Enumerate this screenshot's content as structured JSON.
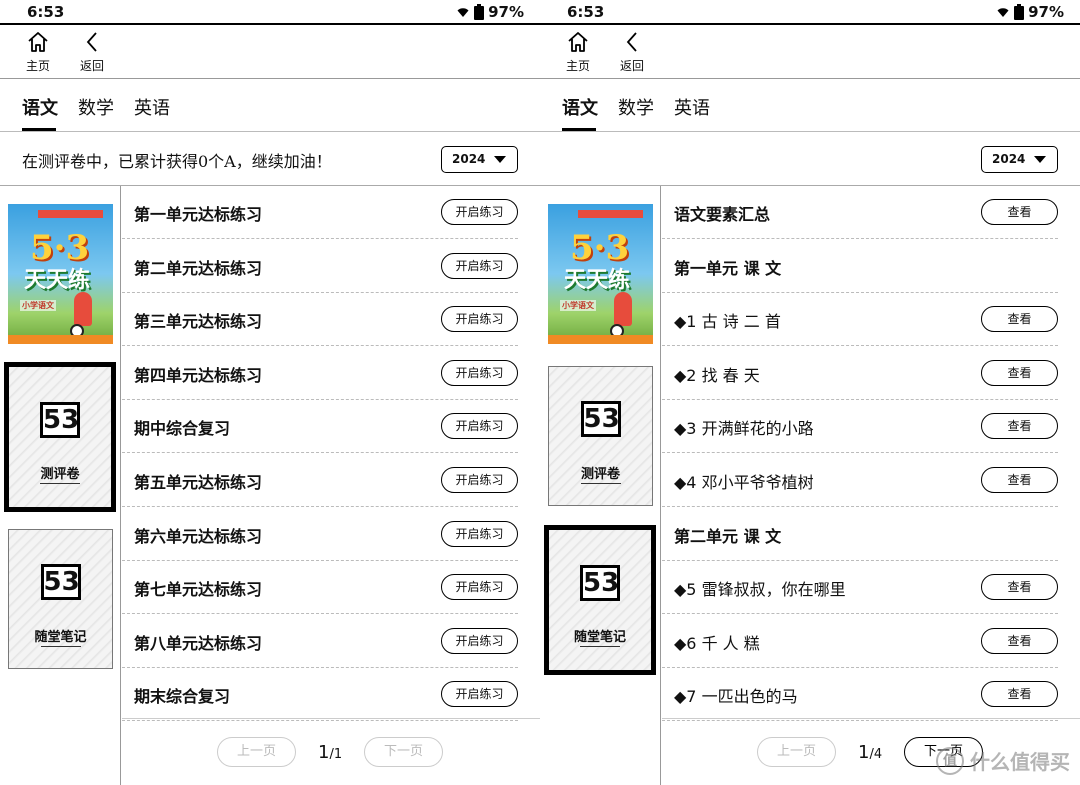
{
  "status": {
    "time": "6:53",
    "battery": "97%"
  },
  "nav": {
    "home_label": "主页",
    "back_label": "返回"
  },
  "tabs": [
    "语文",
    "数学",
    "英语"
  ],
  "notice": "在测评卷中，已累计获得0个A，继续加油！",
  "year": "2024",
  "sidebar": {
    "cover_num": "5·3",
    "cover_title": "天天练",
    "cover_sub": "小学语文",
    "logo": "53",
    "test_name": "测评卷",
    "notes_name": "随堂笔记"
  },
  "left": {
    "button_label": "开启练习",
    "items": [
      "第一单元达标练习",
      "第二单元达标练习",
      "第三单元达标练习",
      "第四单元达标练习",
      "期中综合复习",
      "第五单元达标练习",
      "第六单元达标练习",
      "第七单元达标练习",
      "第八单元达标练习",
      "期末综合复习"
    ],
    "page_current": "1",
    "page_total": "/1"
  },
  "right": {
    "button_label": "查看",
    "items": [
      {
        "text": "语文要素汇总",
        "section": true,
        "button": true
      },
      {
        "text": "第一单元 课 文",
        "section": true,
        "button": false
      },
      {
        "text": "◆1 古 诗 二 首",
        "section": false,
        "button": true
      },
      {
        "text": "◆2 找 春 天",
        "section": false,
        "button": true
      },
      {
        "text": "◆3 开满鲜花的小路",
        "section": false,
        "button": true
      },
      {
        "text": "◆4 邓小平爷爷植树",
        "section": false,
        "button": true
      },
      {
        "text": "第二单元 课 文",
        "section": true,
        "button": false
      },
      {
        "text": "◆5 雷锋叔叔，你在哪里",
        "section": false,
        "button": true
      },
      {
        "text": "◆6 千 人 糕",
        "section": false,
        "button": true
      },
      {
        "text": "◆7 一匹出色的马",
        "section": false,
        "button": true
      }
    ],
    "page_current": "1",
    "page_total": "/4"
  },
  "pager": {
    "prev": "上一页",
    "next": "下一页"
  },
  "watermark": "什么值得买"
}
